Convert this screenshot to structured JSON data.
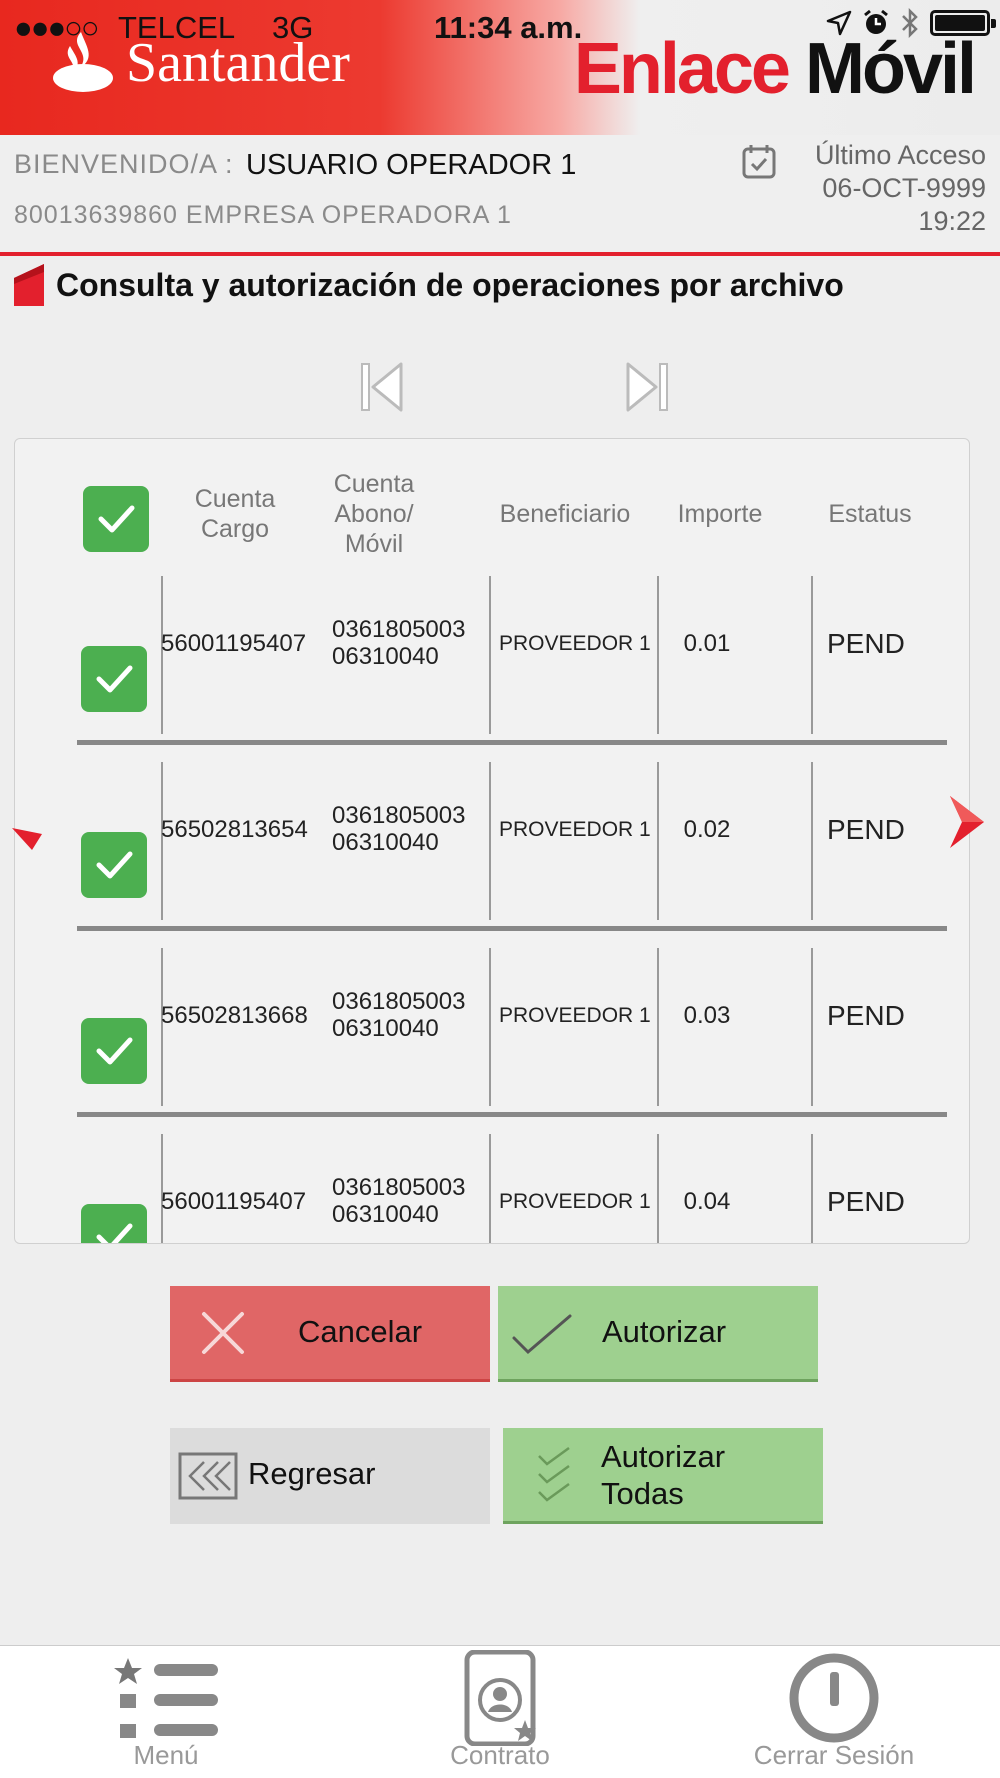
{
  "status_bar": {
    "signal": "●●●○○",
    "carrier": "TELCEL",
    "network": "3G",
    "time": "11:34 a.m."
  },
  "header": {
    "brand": "Santander",
    "app_name_1": "Enlace",
    "app_name_2": "Móvil",
    "brand_color": "#e3202d"
  },
  "welcome": {
    "label": "BIENVENIDO/A :",
    "user": "USUARIO OPERADOR 1",
    "company": "80013639860  EMPRESA OPERADORA 1",
    "last_access_label": "Último Acceso",
    "last_access_date": "06-OCT-9999",
    "last_access_time": "19:22"
  },
  "page_title": "Consulta y autorización de operaciones por archivo",
  "table": {
    "headers": {
      "cargo_1": "Cuenta",
      "cargo_2": "Cargo",
      "abono_1": "Cuenta",
      "abono_2": "Abono/",
      "abono_3": "Móvil",
      "beneficiario": "Beneficiario",
      "importe": "Importe",
      "estatus": "Estatus"
    },
    "rows": [
      {
        "cargo": "56001195407",
        "abono_1": "0361805003",
        "abono_2": "06310040",
        "beneficiario": "PROVEEDOR 1",
        "importe": "0.01",
        "estatus": "PEND",
        "checked": true
      },
      {
        "cargo": "56502813654",
        "abono_1": "0361805003",
        "abono_2": "06310040",
        "beneficiario": "PROVEEDOR 1",
        "importe": "0.02",
        "estatus": "PEND",
        "checked": true
      },
      {
        "cargo": "56502813668",
        "abono_1": "0361805003",
        "abono_2": "06310040",
        "beneficiario": "PROVEEDOR 1",
        "importe": "0.03",
        "estatus": "PEND",
        "checked": true
      },
      {
        "cargo": "56001195407",
        "abono_1": "0361805003",
        "abono_2": "06310040",
        "beneficiario": "PROVEEDOR 1",
        "importe": "0.04",
        "estatus": "PEND",
        "checked": true
      }
    ]
  },
  "buttons": {
    "cancel": "Cancelar",
    "authorize": "Autorizar",
    "back": "Regresar",
    "authorize_all_1": "Autorizar",
    "authorize_all_2": "Todas"
  },
  "bottom_nav": {
    "menu": "Menú",
    "contract": "Contrato",
    "logout": "Cerrar Sesión"
  },
  "colors": {
    "cancel": "#e06666",
    "authorize": "#9ed08f",
    "checkbox": "#4caf50"
  }
}
